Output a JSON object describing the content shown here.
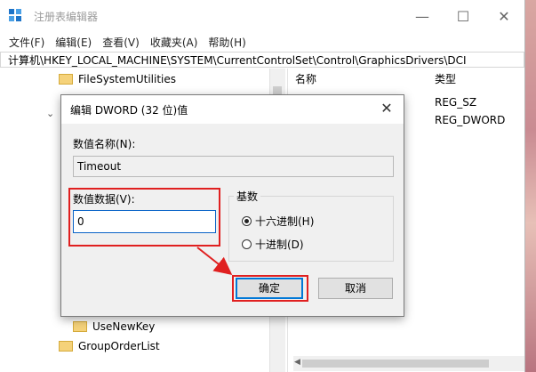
{
  "window": {
    "title": "注册表编辑器",
    "controls": {
      "minimize": "—",
      "maximize": "☐",
      "close": "✕"
    }
  },
  "menu": [
    "文件(F)",
    "编辑(E)",
    "查看(V)",
    "收藏夹(A)",
    "帮助(H)"
  ],
  "address_path": "计算机\\HKEY_LOCAL_MACHINE\\SYSTEM\\CurrentControlSet\\Control\\GraphicsDrivers\\DCI",
  "tree": {
    "items": [
      {
        "label": "FileSystemUtilities"
      },
      {
        "label": "UseNewKey"
      },
      {
        "label": "GroupOrderList"
      }
    ]
  },
  "list": {
    "columns": {
      "name": "名称",
      "type": "类型"
    },
    "types": [
      "REG_SZ",
      "REG_DWORD"
    ]
  },
  "dialog": {
    "title": "编辑 DWORD (32 位)值",
    "close": "✕",
    "name_label": "数值名称(N):",
    "name_value": "Timeout",
    "data_label": "数值数据(V):",
    "data_value": "0",
    "base_label": "基数",
    "radio_hex": "十六进制(H)",
    "radio_dec": "十进制(D)",
    "ok": "确定",
    "cancel": "取消"
  },
  "colors": {
    "highlight_red": "#e02020",
    "accent_blue": "#0078d7"
  }
}
